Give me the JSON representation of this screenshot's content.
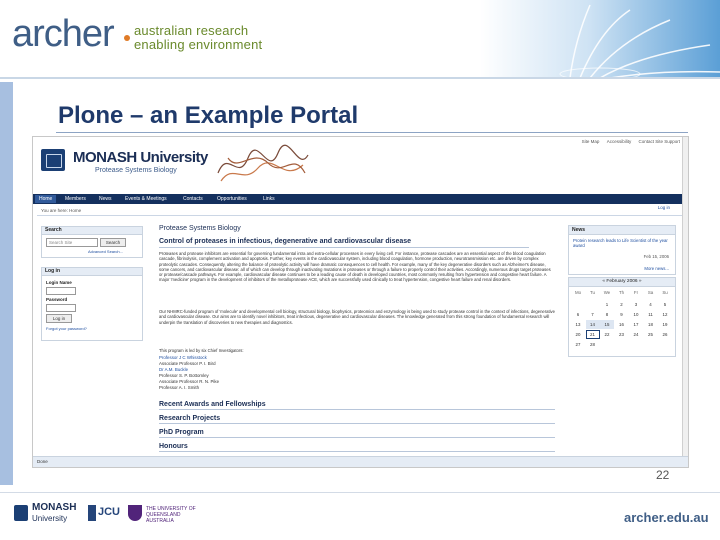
{
  "header": {
    "logo_text": "archer",
    "tagline_line1": "australian research",
    "tagline_line2": "enabling environment"
  },
  "slide": {
    "title": "Plone – an Example Portal",
    "page_number": "22",
    "footer_url": "archer.edu.au"
  },
  "footer_logos": {
    "monash": "MONASH",
    "monash_sub": "University",
    "jcu": "JCU",
    "uq": "THE UNIVERSITY OF QUEENSLAND AUSTRALIA"
  },
  "portal": {
    "util_links": [
      "Site Map",
      "Accessibility",
      "Contact Site Support"
    ],
    "university": "MONASH University",
    "lab_name": "Protease Systems Biology",
    "nav": [
      "Home",
      "Members",
      "News",
      "Events & Meetings",
      "Contacts",
      "Opportunities",
      "Links"
    ],
    "breadcrumb": "You are here: Home",
    "login_link": "Log in",
    "search": {
      "title": "Search",
      "placeholder": "Search Site",
      "button": "Search",
      "advanced": "Advanced Search..."
    },
    "login": {
      "title": "Log in",
      "name_label": "Login Name",
      "password_label": "Password",
      "button": "Log in",
      "forgot": "Forgot your password?"
    },
    "main": {
      "site_heading": "Protease Systems Biology",
      "heading": "Control of proteases in infectious, degenerative and cardiovascular disease",
      "para1": "Proteases and protease inhibitors are essential for governing fundamental intra and extra-cellular processes in every living cell. For instance, protease cascades are an essential aspect of the blood coagulation cascade, fibrinolysis, complement activation and apoptosis. Further, key events in the cardiovascular system, including blood coagulation, hormone production, neurotransmission etc. are driven by complex proteolytic cascades. Consequently, altering the balance of proteolytic activity will have dramatic consequences to cell health. For example, many of the key degenerative disorders such as Alzheimer's disease, some cancers, and cardiovascular disease: all of which can develop through inactivating mutations in proteases or through a failure to properly control their activities. Accordingly, numerous drugs target proteases or protease/cascade pathways. For example, cardiovascular disease continues to be a leading cause of death in developed countries, most commonly resulting from hypertension and congestive heart failure. A major 'medicine' program in the development of inhibitors of the metalloprotease ACE, which are successfully used clinically to treat hypertension, congestive heart failure and renal disorders.",
      "para2": "Our NHMRC-funded program of 'molecule' and developmental cell biology, structural biology, biophysics, proteomics and enzymology is being used to study protease control in the context of infections, degenerative and cardiovascular disease. Our aims are to identify novel inhibitors, treat infectious, degenerative and cardiovascular diseases. The knowledge generated from this strong foundation of fundamental research will underpin the translation of discoveries to new therapies and diagnostics.",
      "para3": "This program is led by six Chief Investigators:",
      "investigators": [
        "Professor J C Whisstock",
        "Associate Professor P. I. Bird",
        "Dr A.M. Buckle",
        "Professor S. P. Bottomley",
        "Associate Professor R. N. Pike",
        "Professor A. I. Smith"
      ],
      "sections": [
        "Recent Awards and Fellowships",
        "Research Projects",
        "PhD Program",
        "Honours"
      ]
    },
    "news": {
      "title": "News",
      "item": "Protein research leads to Life Scientist of the year award",
      "date": "Feb 15, 2006",
      "more": "More news..."
    },
    "calendar": {
      "title": "« February 2006 »",
      "weekdays": [
        "Mo",
        "Tu",
        "We",
        "Th",
        "Fr",
        "Sa",
        "Su"
      ],
      "days": [
        "",
        "",
        "1",
        "2",
        "3",
        "4",
        "5",
        "6",
        "7",
        "8",
        "9",
        "10",
        "11",
        "12",
        "13",
        "14",
        "15",
        "16",
        "17",
        "18",
        "19",
        "20",
        "21",
        "22",
        "23",
        "24",
        "25",
        "26",
        "27",
        "28",
        "",
        "",
        "",
        "",
        ""
      ],
      "today": "21",
      "event_days": [
        "14",
        "15"
      ]
    },
    "status": "Done"
  }
}
